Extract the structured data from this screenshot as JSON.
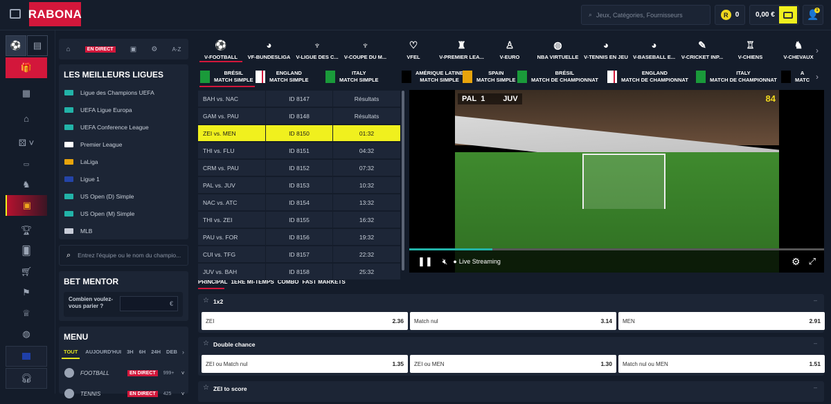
{
  "header": {
    "logo": "RABONA",
    "search_placeholder": "Jeux, Catégories, Fournisseurs",
    "coins": "0",
    "balance": "0,00 €",
    "notif_count": "1"
  },
  "left": {
    "nav": {
      "live": "EN DIRECT",
      "az": "A-Z"
    },
    "top_leagues_title": "LES MEILLEURS LIGUES",
    "leagues": [
      {
        "name": "Ligue des Champions UEFA",
        "flag": "#22b3a8"
      },
      {
        "name": "UEFA Ligue Europa",
        "flag": "#22b3a8"
      },
      {
        "name": "UEFA Conference League",
        "flag": "#22b3a8"
      },
      {
        "name": "Premier League",
        "flag": "#ffffff"
      },
      {
        "name": "LaLiga",
        "flag": "#e8a40c"
      },
      {
        "name": "Ligue 1",
        "flag": "#2444a8"
      },
      {
        "name": "US Open (D) Simple",
        "flag": "#22b3a8"
      },
      {
        "name": "US Open (M) Simple",
        "flag": "#22b3a8"
      },
      {
        "name": "MLB",
        "flag": "#c8ccd8"
      }
    ],
    "search_placeholder": "Entrez l'équipe ou le nom du champio...",
    "bet_mentor": {
      "title": "BET MENTOR",
      "question": "Combien voulez-vous parier ?",
      "currency": "€"
    },
    "menu": {
      "title": "MENU",
      "filters": [
        "TOUT",
        "AUJOURD'HUI",
        "3H",
        "6H",
        "24H",
        "DEB"
      ],
      "sports": [
        {
          "name": "FOOTBALL",
          "live": "EN DIRECT",
          "count": "999+"
        },
        {
          "name": "TENNIS",
          "live": "EN DIRECT",
          "count": "425"
        }
      ]
    }
  },
  "sport_tabs": [
    "V-FOOTBALL",
    "VF-BUNDESLIGA",
    "V-LIGUE DES C...",
    "V-COUPE DU M...",
    "VFEL",
    "V-PREMIER LEA...",
    "V-EURO",
    "NBA VIRTUELLE",
    "V-TENNIS EN JEU",
    "V-BASEBALL E...",
    "V-CRICKET INP...",
    "V-CHIENS",
    "V-CHEVAUX"
  ],
  "league_tabs": [
    {
      "l1": "BRÉSIL",
      "l2": "MATCH SIMPLE"
    },
    {
      "l1": "ENGLAND",
      "l2": "MATCH SIMPLE"
    },
    {
      "l1": "ITALY",
      "l2": "MATCH SIMPLE"
    },
    {
      "l1": "AMÉRIQUE LATINE",
      "l2": "MATCH SIMPLE"
    },
    {
      "l1": "SPAIN",
      "l2": "MATCH SIMPLE"
    },
    {
      "l1": "BRÉSIL",
      "l2": "MATCH DE CHAMPIONNAT"
    },
    {
      "l1": "ENGLAND",
      "l2": "MATCH DE CHAMPIONNAT"
    },
    {
      "l1": "ITALY",
      "l2": "MATCH DE CHAMPIONNAT"
    },
    {
      "l1": "A",
      "l2": "MATC"
    }
  ],
  "matches": [
    {
      "teams": "BAH vs. NAC",
      "id": "ID 8147",
      "time": "Résultats"
    },
    {
      "teams": "GAM vs. PAU",
      "id": "ID 8148",
      "time": "Résultats"
    },
    {
      "teams": "ZEI vs. MEN",
      "id": "ID 8150",
      "time": "01:32"
    },
    {
      "teams": "THI vs. FLU",
      "id": "ID 8151",
      "time": "04:32"
    },
    {
      "teams": "CRM vs. PAU",
      "id": "ID 8152",
      "time": "07:32"
    },
    {
      "teams": "PAL vs. JUV",
      "id": "ID 8153",
      "time": "10:32"
    },
    {
      "teams": "NAC vs. ATC",
      "id": "ID 8154",
      "time": "13:32"
    },
    {
      "teams": "THI vs. ZEI",
      "id": "ID 8155",
      "time": "16:32"
    },
    {
      "teams": "PAU vs. FOR",
      "id": "ID 8156",
      "time": "19:32"
    },
    {
      "teams": "CUI vs. TFG",
      "id": "ID 8157",
      "time": "22:32"
    },
    {
      "teams": "JUV vs. BAH",
      "id": "ID 8158",
      "time": "25:32"
    }
  ],
  "video": {
    "home": "PAL",
    "score": "1",
    "away": "JUV",
    "minute": "84",
    "live_label": "Live Streaming",
    "progress": 0.2
  },
  "market_tabs": [
    "PRINCIPAL",
    "1ÈRE MI-TEMPS",
    "COMBO",
    "FAST MARKETS"
  ],
  "markets": [
    {
      "title": "1x2",
      "odds": [
        {
          "label": "ZEI",
          "value": "2.36"
        },
        {
          "label": "Match nul",
          "value": "3.14"
        },
        {
          "label": "MEN",
          "value": "2.91"
        }
      ]
    },
    {
      "title": "Double chance",
      "odds": [
        {
          "label": "ZEI ou Match nul",
          "value": "1.35"
        },
        {
          "label": "ZEI ou MEN",
          "value": "1.30"
        },
        {
          "label": "Match nul ou MEN",
          "value": "1.51"
        }
      ]
    },
    {
      "title": "ZEI to score",
      "odds": []
    }
  ],
  "colors": {
    "brand": "#d3173b",
    "accent": "#f0f01e"
  }
}
